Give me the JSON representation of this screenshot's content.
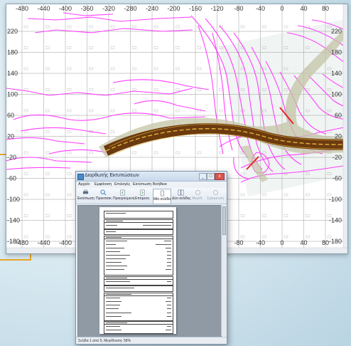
{
  "canvas": {
    "x_labels": [
      "-480",
      "-440",
      "-400",
      "-360",
      "-320",
      "-280",
      "-240",
      "-200",
      "-160",
      "-120",
      "-80",
      "-40",
      "0",
      "40",
      "80"
    ],
    "y_labels": [
      "220",
      "180",
      "140",
      "100",
      "60",
      "20",
      "-20",
      "-60",
      "-100",
      "-140",
      "-180"
    ],
    "grid_color": "#9a9a9a",
    "contour_color": "#ff3cff",
    "road_color": "#6b3a0f",
    "road_centerline_color": "#e3b23a",
    "section_line_color": "#e8262b"
  },
  "dialog": {
    "title": "Διορθωτής Εκτυπώσεων",
    "menu": [
      "Αρχείο",
      "Εμφάνιση",
      "Επιλογές",
      "Εκτύπωση",
      "Βοήθεια"
    ],
    "toolbar": [
      {
        "label": "Εκτύπωση",
        "icon": "printer-icon"
      },
      {
        "label": "Προεπισκ.",
        "icon": "preview-icon"
      },
      {
        "label": "Προηγούμενη",
        "icon": "prev-page-icon"
      },
      {
        "label": "Επόμενη",
        "icon": "next-page-icon"
      },
      {
        "label": "Μία σελίδα",
        "icon": "one-page-icon"
      },
      {
        "label": "Δύο σελίδες",
        "icon": "two-pages-icon"
      },
      {
        "label": "Μεγέθ.",
        "icon": "zoom-in-icon"
      },
      {
        "label": "Σμίκρυνση",
        "icon": "zoom-out-icon"
      }
    ],
    "status": "Σελίδα 1 από 5, Μεγέθυνση: 58%",
    "title_buttons": [
      "_",
      "□",
      "x"
    ]
  },
  "colors": {
    "accent": "#e8a825",
    "window_bg": "#ffffff",
    "desktop_bg": "#d4e6ef"
  }
}
